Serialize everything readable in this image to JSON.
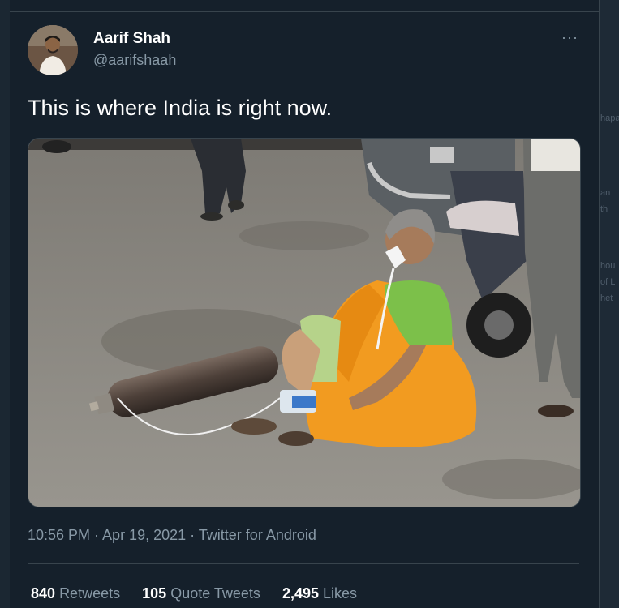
{
  "tweet": {
    "author_name": "Aarif Shah",
    "author_handle": "@aarifshaah",
    "more_label": "···",
    "text": "This is where India is right now.",
    "timestamp": "10:56 PM · Apr 19, 2021 · Twitter for Android",
    "stats": {
      "retweets_count": "840",
      "retweets_label": "Retweets",
      "quote_count": "105",
      "quote_label": "Quote Tweets",
      "likes_count": "2,495",
      "likes_label": "Likes"
    }
  },
  "background_fragments": [
    "hapa",
    "an",
    "th",
    "hou",
    "of L",
    "het"
  ]
}
